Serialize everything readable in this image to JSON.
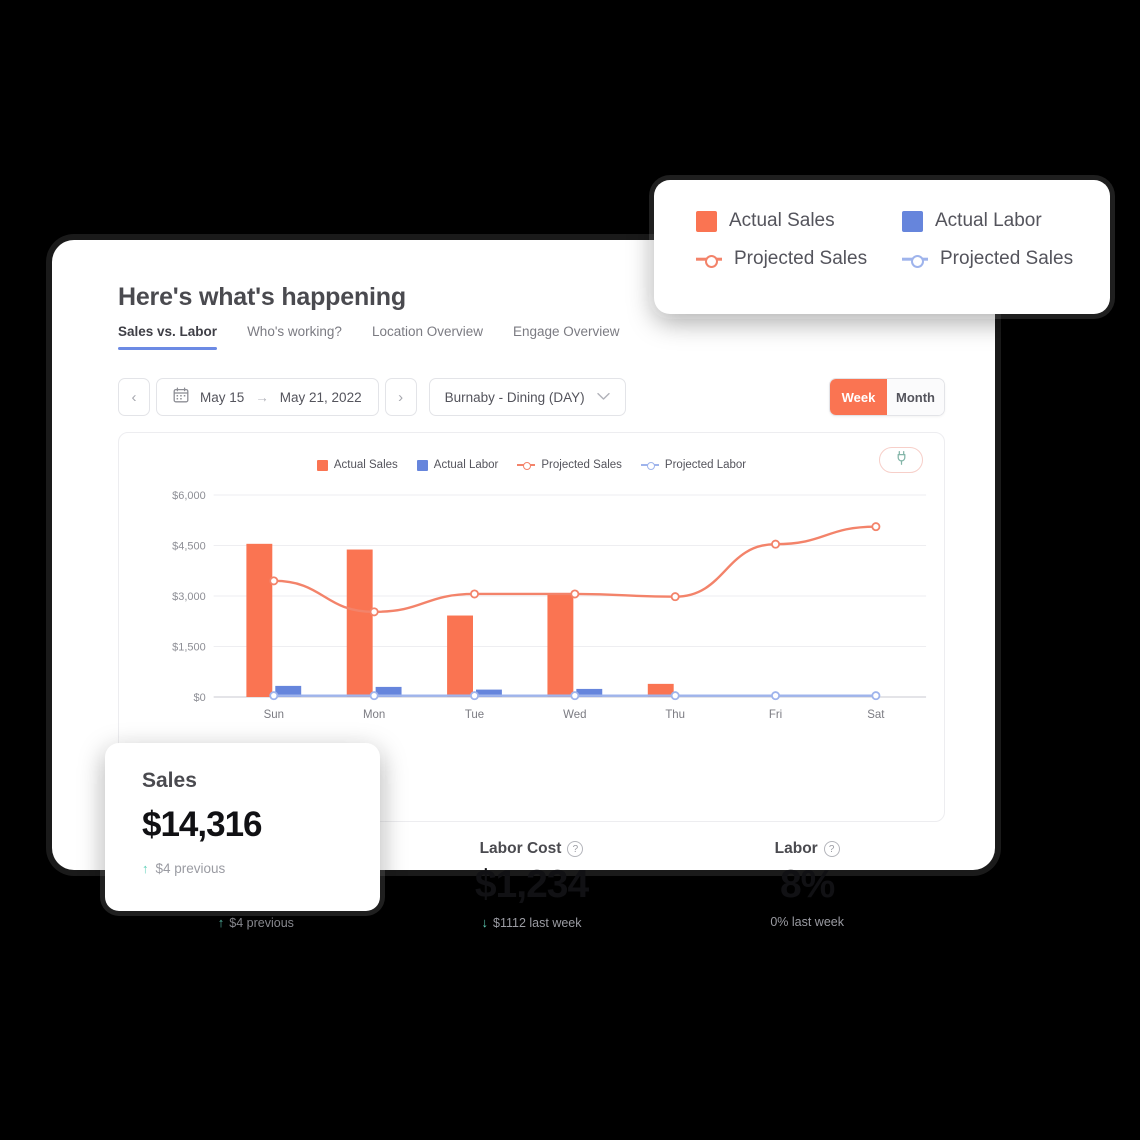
{
  "window": {
    "title": "Here's what's happening",
    "tabs": [
      {
        "label": "Sales vs. Labor",
        "active": true
      },
      {
        "label": "Who's working?",
        "active": false
      },
      {
        "label": "Location Overview",
        "active": false
      },
      {
        "label": "Engage Overview",
        "active": false
      }
    ]
  },
  "toolbar": {
    "prev_label": "‹",
    "next_label": "›",
    "calendar_icon": "calendar-icon",
    "date_range": "May 15  →  May 21, 2022",
    "date_start": "May 15",
    "date_arrow": "→",
    "date_end": "May 21, 2022",
    "location": "Burnaby - Dining (DAY)",
    "chevron": "⌄",
    "range_options": [
      {
        "label": "Week",
        "selected": true
      },
      {
        "label": "Month",
        "selected": false
      }
    ]
  },
  "chart_card": {
    "legend": [
      {
        "label": "Actual Sales",
        "type": "swatch",
        "color": "#fa7452"
      },
      {
        "label": "Actual Labor",
        "type": "swatch",
        "color": "#6685dc"
      },
      {
        "label": "Projected Sales",
        "type": "line",
        "color": "#f3836a"
      },
      {
        "label": "Projected Labor",
        "type": "line",
        "color": "#9fb4ec"
      }
    ],
    "plug_button_icon": "plug-icon"
  },
  "chart_data": {
    "type": "bar",
    "title": "",
    "xlabel": "",
    "ylabel": "",
    "categories": [
      "Sun",
      "Mon",
      "Tue",
      "Wed",
      "Thu",
      "Fri",
      "Sat"
    ],
    "ylim": [
      0,
      6000
    ],
    "yticks": [
      0,
      1500,
      3000,
      4500,
      6000
    ],
    "ytick_labels": [
      "$0",
      "$1,500",
      "$3,000",
      "$4,500",
      "$6,000"
    ],
    "grid": true,
    "legend_position": "top-center",
    "series": [
      {
        "name": "Actual Sales",
        "type": "bar",
        "color": "#fa7452",
        "values": [
          4550,
          4380,
          2420,
          3050,
          390,
          0,
          0
        ]
      },
      {
        "name": "Actual Labor",
        "type": "bar",
        "color": "#6685dc",
        "values": [
          330,
          300,
          220,
          240,
          0,
          0,
          0
        ]
      },
      {
        "name": "Projected Sales",
        "type": "line",
        "color": "#f3836a",
        "values": [
          3450,
          2530,
          3060,
          3060,
          2980,
          4540,
          5060
        ]
      },
      {
        "name": "Projected Labor",
        "type": "line",
        "color": "#9fb4ec",
        "values": [
          40,
          40,
          40,
          40,
          40,
          40,
          40
        ]
      }
    ]
  },
  "stats": [
    {
      "title": "Sales",
      "value": "$14,316",
      "sub": "$4 previous",
      "trend": "up",
      "has_help": false
    },
    {
      "title": "Labor Cost",
      "value": "$1,234",
      "sub": "$1112 last week",
      "trend": "down",
      "has_help": true
    },
    {
      "title": "Labor",
      "value": "8%",
      "sub": "0% last week",
      "trend": "none",
      "has_help": true
    }
  ],
  "legend_callout": {
    "items": [
      {
        "label": "Actual Sales",
        "type": "swatch",
        "color": "#fa7452"
      },
      {
        "label": "Actual Labor",
        "type": "swatch",
        "color": "#6685dc"
      },
      {
        "label": "Projected Sales",
        "type": "line",
        "color": "#f3836a"
      },
      {
        "label": "Projected Sales",
        "type": "line",
        "color": "#9fb4ec"
      }
    ]
  },
  "sales_callout": {
    "title": "Sales",
    "value": "$14,316",
    "sub": "$4 previous",
    "trend_icon": "↑"
  },
  "colors": {
    "accent_orange": "#fa7452",
    "accent_blue": "#6685dc",
    "projected_sales": "#f3836a",
    "projected_labor": "#9fb4ec",
    "trend_green": "#5fcfb8",
    "background": "#000000"
  }
}
